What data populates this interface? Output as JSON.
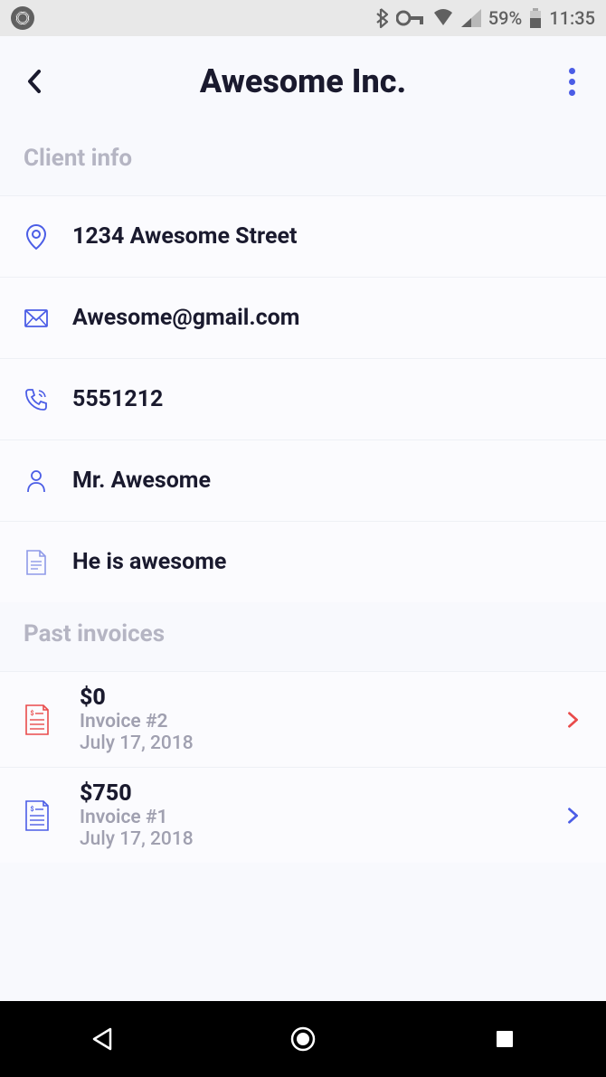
{
  "statusBar": {
    "battery": "59%",
    "time": "11:35"
  },
  "header": {
    "title": "Awesome Inc."
  },
  "clientInfo": {
    "label": "Client info",
    "address": "1234 Awesome Street",
    "email": "Awesome@gmail.com",
    "phone": "5551212",
    "contact": "Mr. Awesome",
    "notes": "He is awesome"
  },
  "pastInvoices": {
    "label": "Past invoices",
    "items": [
      {
        "amount": "$0",
        "name": "Invoice #2",
        "date": "July 17, 2018",
        "accent": "#e94b4b"
      },
      {
        "amount": "$750",
        "name": "Invoice #1",
        "date": "July 17, 2018",
        "accent": "#4b5de6"
      }
    ]
  }
}
